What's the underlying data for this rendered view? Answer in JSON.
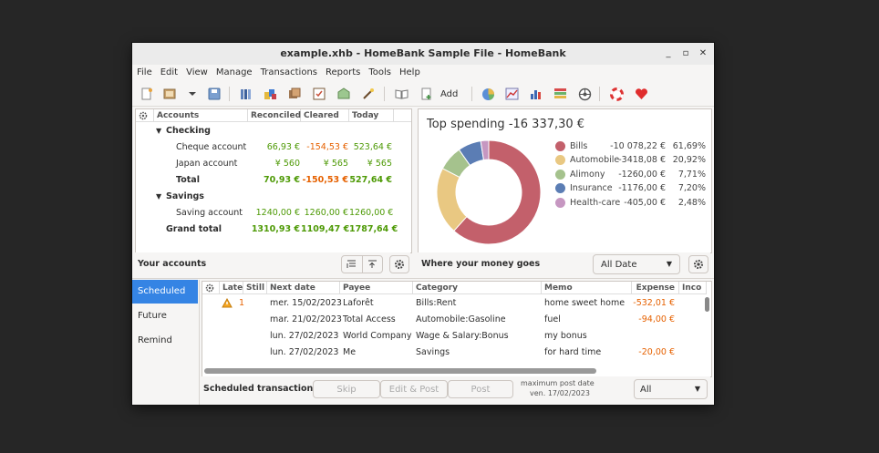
{
  "window": {
    "title": "example.xhb - HomeBank Sample File - HomeBank",
    "minimize": "_",
    "maximize": "▫",
    "close": "✕"
  },
  "menu": [
    "File",
    "Edit",
    "View",
    "Manage",
    "Transactions",
    "Reports",
    "Tools",
    "Help"
  ],
  "toolbar": {
    "add_label": "Add"
  },
  "accounts": {
    "headers": {
      "name": "Accounts",
      "reconciled": "Reconciled",
      "cleared": "Cleared",
      "today": "Today"
    },
    "groups": [
      {
        "label": "Checking"
      },
      {
        "label": "Savings"
      }
    ],
    "rows": [
      {
        "name": "Cheque account",
        "reconciled": "66,93 €",
        "cleared": "-154,53 €",
        "today": "523,64 €"
      },
      {
        "name": "Japan account",
        "reconciled": "¥ 560",
        "cleared": "¥ 565",
        "today": "¥ 565"
      },
      {
        "name": "Total",
        "reconciled": "70,93 €",
        "cleared": "-150,53 €",
        "today": "527,64 €"
      },
      {
        "name": "Saving account",
        "reconciled": "1240,00 €",
        "cleared": "1260,00 €",
        "today": "1260,00 €"
      },
      {
        "name": "Grand total",
        "reconciled": "1310,93 €",
        "cleared": "1109,47 €",
        "today": "1787,64 €"
      }
    ],
    "footer_label": "Your accounts"
  },
  "spending": {
    "title": "Top spending -16 337,30 €",
    "footer_label": "Where your money goes",
    "range_value": "All Date",
    "colors": {
      "bills": "#c3606b",
      "automobile": "#e9c882",
      "alimony": "#a5c28d",
      "insurance": "#5b7db4",
      "health": "#c697c1"
    },
    "legend": [
      {
        "name": "Bills",
        "amount": "-10 078,22 €",
        "percent": "61,69%"
      },
      {
        "name": "Automobile",
        "amount": "-3418,08 €",
        "percent": "20,92%"
      },
      {
        "name": "Alimony",
        "amount": "-1260,00 €",
        "percent": "7,71%"
      },
      {
        "name": "Insurance",
        "amount": "-1176,00 €",
        "percent": "7,20%"
      },
      {
        "name": "Health-care",
        "amount": "-405,00 €",
        "percent": "2,48%"
      }
    ]
  },
  "chart_data": {
    "type": "pie",
    "title": "Top spending -16 337,30 €",
    "categories": [
      "Bills",
      "Automobile",
      "Alimony",
      "Insurance",
      "Health-care"
    ],
    "values": [
      10078.22,
      3418.08,
      1260.0,
      1176.0,
      405.0
    ],
    "percent": [
      61.69,
      20.92,
      7.71,
      7.2,
      2.48
    ]
  },
  "tabs": {
    "scheduled": "Scheduled",
    "future": "Future",
    "remind": "Remind"
  },
  "schedule": {
    "headers": {
      "late": "Late",
      "still": "Still",
      "next_date": "Next date",
      "payee": "Payee",
      "category": "Category",
      "memo": "Memo",
      "expense": "Expense",
      "income": "Inco"
    },
    "rows": [
      {
        "still": "1",
        "date": "mer. 15/02/2023",
        "payee": "Laforêt",
        "category": "Bills:Rent",
        "memo": "home sweet home",
        "expense": "-532,01 €"
      },
      {
        "still": "",
        "date": "mar. 21/02/2023",
        "payee": "Total Access",
        "category": "Automobile:Gasoline",
        "memo": "fuel",
        "expense": "-94,00 €"
      },
      {
        "still": "",
        "date": "lun. 27/02/2023",
        "payee": "World Company",
        "category": "Wage & Salary:Bonus",
        "memo": "my bonus",
        "expense": ""
      },
      {
        "still": "",
        "date": "lun. 27/02/2023",
        "payee": "Me",
        "category": "Savings",
        "memo": "for hard time",
        "expense": "-20,00 €"
      }
    ],
    "footer_label": "Scheduled transactions",
    "skip": "Skip",
    "edit_post": "Edit & Post",
    "post": "Post",
    "max_label": "maximum post date",
    "max_date": "ven. 17/02/2023",
    "filter_value": "All"
  }
}
